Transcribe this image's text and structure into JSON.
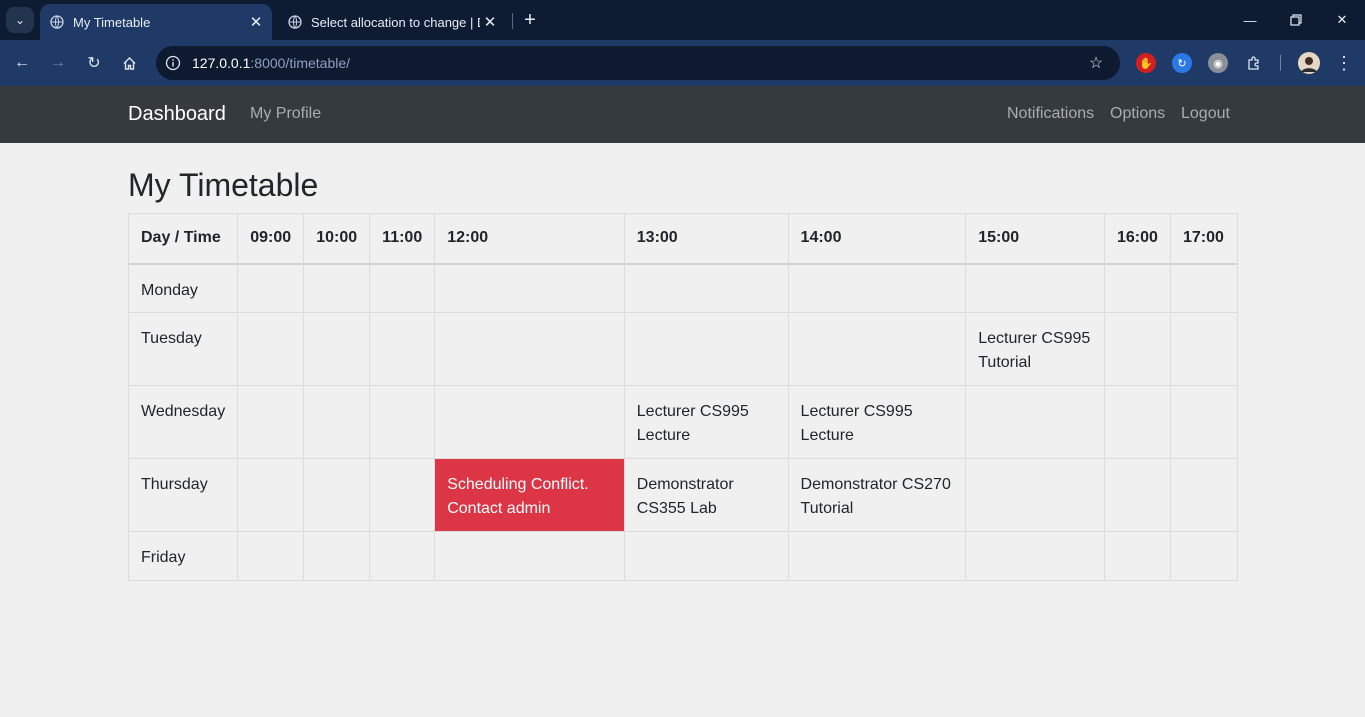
{
  "browser": {
    "tabs": [
      {
        "title": "My Timetable",
        "active": true
      },
      {
        "title": "Select allocation to change | Dja",
        "active": false
      }
    ],
    "url_host": "127.0.0.1",
    "url_rest": ":8000/timetable/",
    "window_controls": [
      "minimize-icon",
      "restore-icon",
      "close-icon"
    ],
    "extensions": [
      "red-hand-icon",
      "blue-refresh-icon",
      "owl-icon",
      "puzzle-icon"
    ],
    "colors": {
      "tabstrip": "#0d1b33",
      "toolbar": "#1f3a66"
    }
  },
  "nav": {
    "brand": "Dashboard",
    "profile": "My Profile",
    "notifications": "Notifications",
    "options": "Options",
    "logout": "Logout"
  },
  "page": {
    "title": "My Timetable"
  },
  "timetable": {
    "header": [
      "Day / Time",
      "09:00",
      "10:00",
      "11:00",
      "12:00",
      "13:00",
      "14:00",
      "15:00",
      "16:00",
      "17:00"
    ],
    "rows": [
      {
        "day": "Monday",
        "cells": [
          "",
          "",
          "",
          "",
          "",
          "",
          "",
          "",
          ""
        ]
      },
      {
        "day": "Tuesday",
        "cells": [
          "",
          "",
          "",
          "",
          "",
          "",
          "Lecturer CS995 Tutorial",
          "",
          ""
        ]
      },
      {
        "day": "Wednesday",
        "cells": [
          "",
          "",
          "",
          "",
          "Lecturer CS995 Lecture",
          "Lecturer CS995 Lecture",
          "",
          "",
          ""
        ]
      },
      {
        "day": "Thursday",
        "cells": [
          "",
          "",
          "",
          "Scheduling Conflict. Contact admin",
          "Demonstrator CS355 Lab",
          "Demonstrator CS270 Tutorial",
          "",
          "",
          ""
        ]
      },
      {
        "day": "Friday",
        "cells": [
          "",
          "",
          "",
          "",
          "",
          "",
          "",
          "",
          ""
        ]
      }
    ],
    "conflict_color": "#dc3545"
  }
}
